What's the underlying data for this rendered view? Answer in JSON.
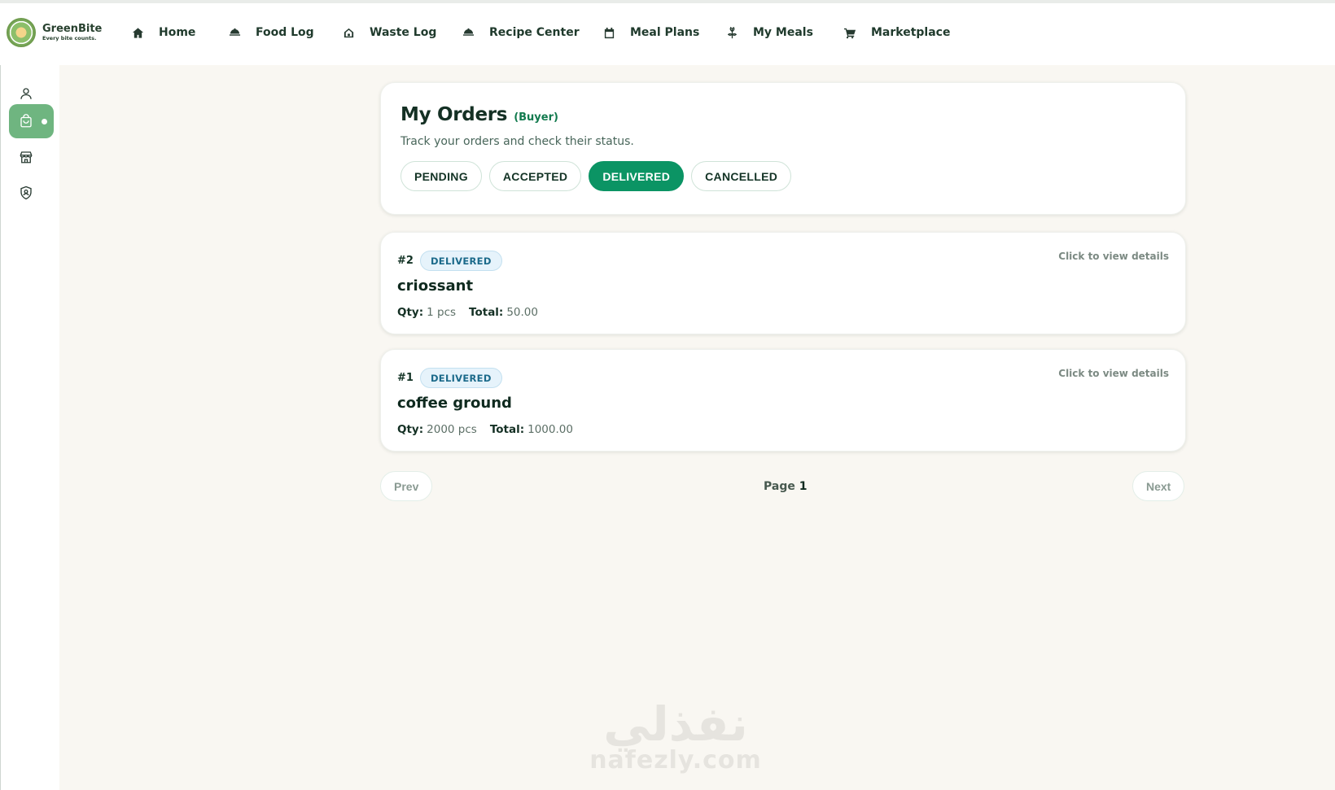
{
  "brand": {
    "name": "GreenBite",
    "tagline": "Every bite counts."
  },
  "nav": [
    {
      "label": "Home",
      "icon": "home-icon"
    },
    {
      "label": "Food Log",
      "icon": "food-cloche-icon"
    },
    {
      "label": "Waste Log",
      "icon": "waste-bin-icon"
    },
    {
      "label": "Recipe Center",
      "icon": "recipe-cloche-icon"
    },
    {
      "label": "Meal Plans",
      "icon": "calendar-icon"
    },
    {
      "label": "My Meals",
      "icon": "wheat-icon"
    },
    {
      "label": "Marketplace",
      "icon": "cart-icon"
    }
  ],
  "sidebar": [
    {
      "icon": "user-icon"
    },
    {
      "icon": "shopping-bag-icon",
      "active": true
    },
    {
      "icon": "store-icon"
    },
    {
      "icon": "shield-user-icon"
    }
  ],
  "header": {
    "title": "My Orders",
    "role": "(Buyer)",
    "subtitle": "Track your orders and check their status."
  },
  "tabs": [
    {
      "label": "PENDING",
      "active": false
    },
    {
      "label": "ACCEPTED",
      "active": false
    },
    {
      "label": "DELIVERED",
      "active": true
    },
    {
      "label": "CANCELLED",
      "active": false
    }
  ],
  "orders": [
    {
      "id": "#2",
      "status": "DELIVERED",
      "name": "criossant",
      "qty_label": "Qty:",
      "qty": "1 pcs",
      "total_label": "Total:",
      "total": "50.00",
      "hint": "Click to view details"
    },
    {
      "id": "#1",
      "status": "DELIVERED",
      "name": "coffee ground",
      "qty_label": "Qty:",
      "qty": "2000 pcs",
      "total_label": "Total:",
      "total": "1000.00",
      "hint": "Click to view details"
    }
  ],
  "pagination": {
    "prev": "Prev",
    "next": "Next",
    "page_label": "Page",
    "page": "1"
  },
  "watermark": {
    "arabic": "نفذلي",
    "latin": "nafezly.com"
  },
  "colors": {
    "accent": "#0b9464",
    "active_sidebar": "#6fb580",
    "background": "#f9f7f2"
  }
}
